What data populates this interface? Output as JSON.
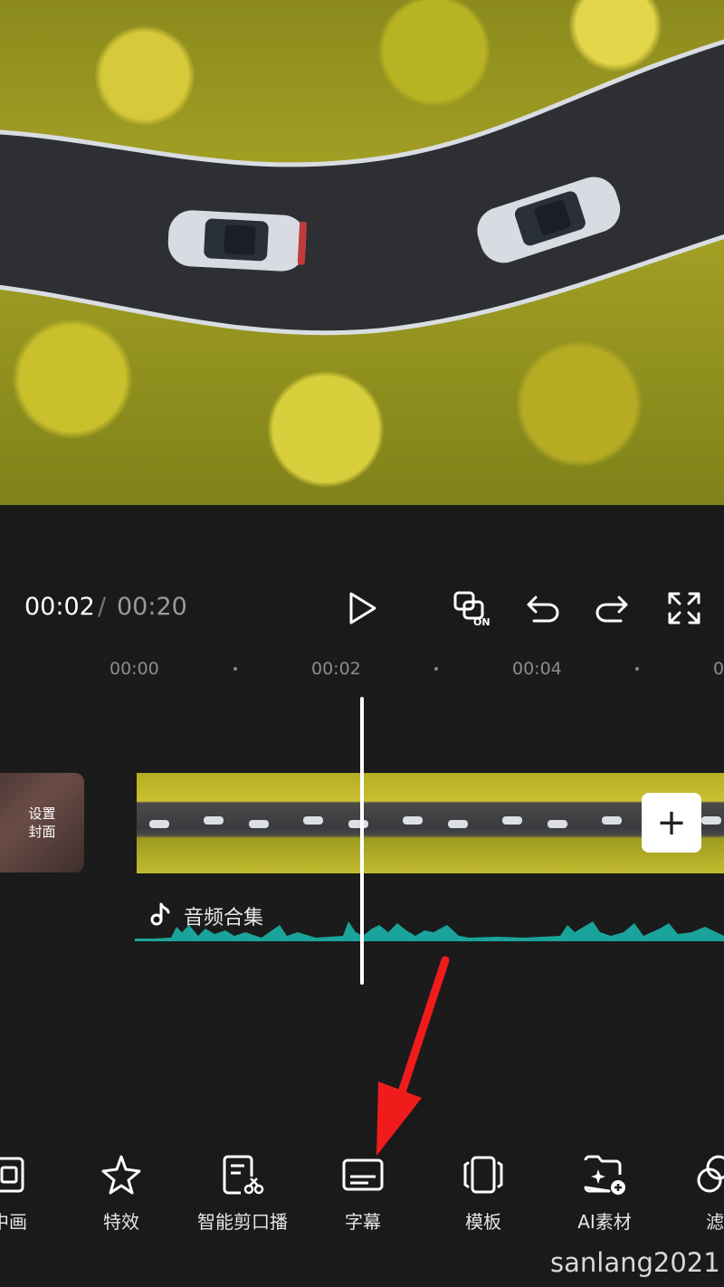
{
  "player": {
    "current_time": "00:02",
    "separator": "/",
    "total_time": "00:20"
  },
  "controls": {
    "play_icon": "play-icon",
    "sync_icon": "keyframe-on-icon",
    "undo_icon": "undo-icon",
    "redo_icon": "redo-icon",
    "fullscreen_icon": "fullscreen-icon"
  },
  "timeline": {
    "ruler": [
      "00:00",
      "00:02",
      "00:04",
      "0"
    ],
    "cover_label": "设置\n封面",
    "audio_label": "音频合集",
    "add_clip": "+"
  },
  "toolbar": {
    "items": [
      {
        "label": "中画",
        "icon": "picture-in-picture-icon"
      },
      {
        "label": "特效",
        "icon": "effects-star-icon"
      },
      {
        "label": "智能剪口播",
        "icon": "smart-cut-icon"
      },
      {
        "label": "字幕",
        "icon": "subtitle-icon"
      },
      {
        "label": "模板",
        "icon": "template-icon"
      },
      {
        "label": "AI素材",
        "icon": "ai-material-icon"
      },
      {
        "label": "滤",
        "icon": "filter-icon"
      }
    ]
  },
  "watermark": "sanlang2021",
  "colors": {
    "background": "#1a1a1a",
    "audio_wave": "#1aa39a",
    "annotation_arrow": "#f01c1c"
  }
}
